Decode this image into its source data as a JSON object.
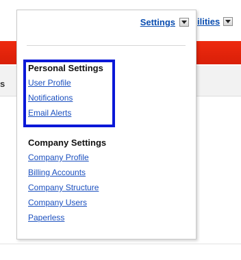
{
  "background": {
    "partial_label": "s",
    "right_menu": {
      "label": "ilities",
      "arrow_icon": "dropdown-arrow-icon"
    },
    "brand_bar_color": "#e3240c"
  },
  "dropdown": {
    "header": {
      "label": "Settings",
      "arrow_icon": "dropdown-arrow-icon"
    },
    "personal": {
      "title": "Personal Settings",
      "items": [
        "User Profile",
        "Notifications",
        "Email Alerts"
      ],
      "highlight_color": "#0a18d8"
    },
    "company": {
      "title": "Company Settings",
      "items": [
        "Company Profile",
        "Billing Accounts",
        "Company Structure",
        "Company Users",
        "Paperless"
      ]
    }
  }
}
